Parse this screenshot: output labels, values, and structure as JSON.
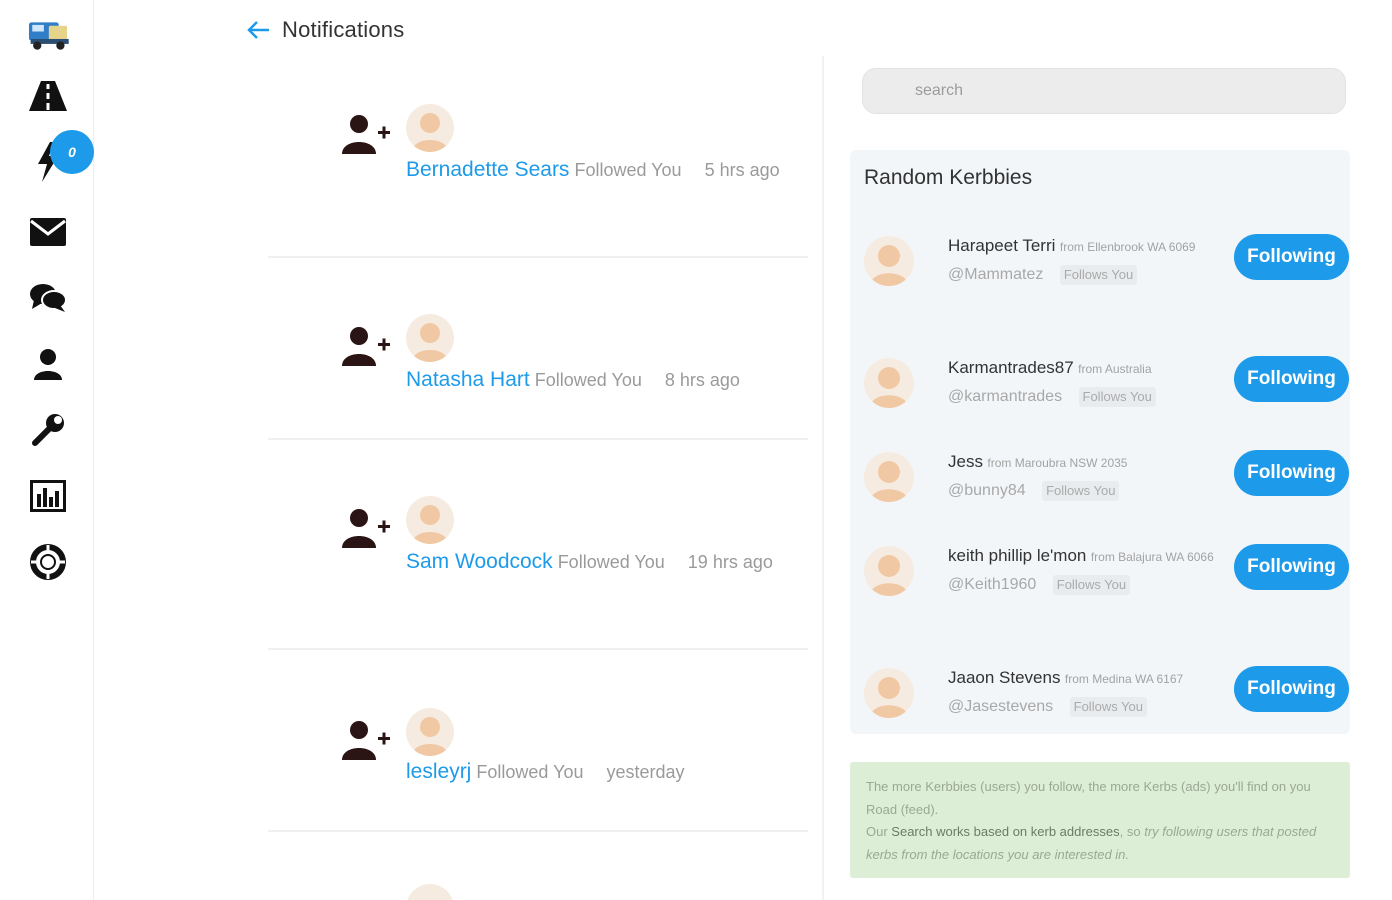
{
  "header": {
    "title": "Notifications",
    "back_icon": "arrow-left-icon"
  },
  "rail": {
    "badge_count": "0",
    "items": [
      {
        "name": "logo-truck",
        "icon": "truck-logo-icon"
      },
      {
        "name": "road",
        "icon": "road-icon"
      },
      {
        "name": "notifications",
        "icon": "lightning-icon"
      },
      {
        "name": "mail",
        "icon": "envelope-icon"
      },
      {
        "name": "chat",
        "icon": "comments-icon"
      },
      {
        "name": "profile",
        "icon": "user-icon"
      },
      {
        "name": "settings",
        "icon": "wrench-icon"
      },
      {
        "name": "stats",
        "icon": "bar-chart-icon"
      },
      {
        "name": "help",
        "icon": "lifebuoy-icon"
      }
    ]
  },
  "notifications": [
    {
      "name": "Bernadette Sears",
      "action": "Followed You",
      "time": "5 hrs ago"
    },
    {
      "name": "Natasha Hart",
      "action": "Followed You",
      "time": "8 hrs ago"
    },
    {
      "name": "Sam Woodcock",
      "action": "Followed You",
      "time": "19 hrs ago"
    },
    {
      "name": "lesleyrj",
      "action": "Followed You",
      "time": "yesterday"
    }
  ],
  "search": {
    "placeholder": "search"
  },
  "random": {
    "title": "Random Kerbbies",
    "follows_you_label": "Follows You",
    "items": [
      {
        "name": "Harapeet Terri",
        "from": "from Ellenbrook WA 6069",
        "handle": "@Mammatez",
        "button": "Following"
      },
      {
        "name": "Karmantrades87",
        "from": "from Australia",
        "handle": "@karmantrades",
        "button": "Following"
      },
      {
        "name": "Jess",
        "from": "from Maroubra NSW 2035",
        "handle": "@bunny84",
        "button": "Following"
      },
      {
        "name": "keith phillip le'mon",
        "from": "from Balajura WA 6066",
        "handle": "@Keith1960",
        "button": "Following"
      },
      {
        "name": "Jaaon Stevens",
        "from": "from Medina WA 6167",
        "handle": "@Jasestevens",
        "button": "Following"
      }
    ]
  },
  "info": {
    "line1": "The more Kerbbies (users) you follow, the more Kerbs (ads) you'll find on you Road (feed).",
    "line2_prefix": "Our ",
    "line2_strong": "Search works based on kerb addresses",
    "line2_suffix": ", so ",
    "line2_em": "try following users that posted kerbs from the locations you are interested in."
  },
  "colors": {
    "accent": "#1d9bea",
    "panel_bg": "#f3f6f9",
    "info_bg": "#dcefd6"
  }
}
